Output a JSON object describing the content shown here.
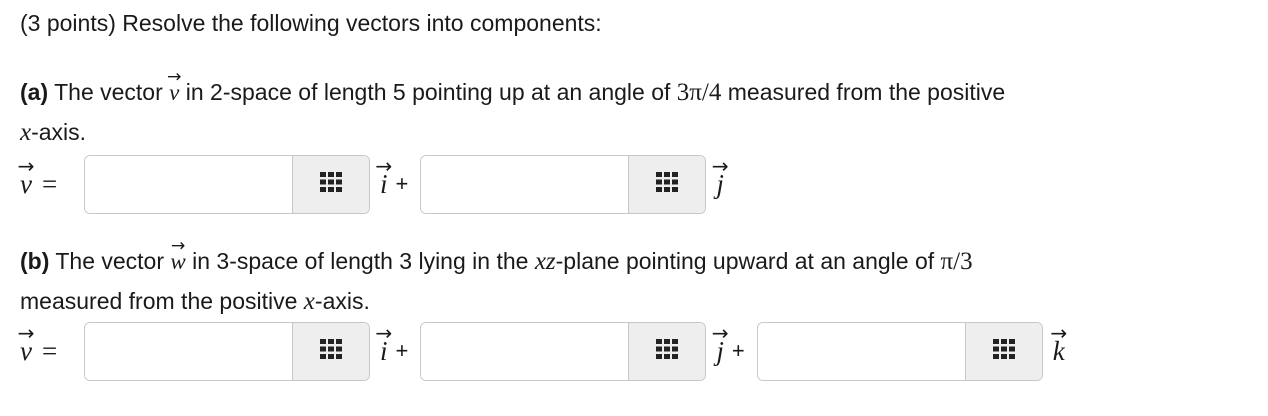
{
  "header": "(3 points) Resolve the following vectors into components:",
  "part_a": {
    "label": "(a)",
    "text1": " The vector ",
    "vec": "v",
    "text2": " in 2-space of length 5 pointing up at an angle of ",
    "angle": "3π/4",
    "text3": " measured from the positive",
    "line2_var": "x",
    "line2_text": "-axis.",
    "lhs": "v",
    "equals": "=",
    "units": [
      "i",
      "j"
    ],
    "plus": "+",
    "answers": [
      "",
      ""
    ]
  },
  "part_b": {
    "label": "(b)",
    "text1": " The vector ",
    "vec": "w",
    "text2": " in 3-space of length 3 lying in the ",
    "plane": "xz",
    "text3": "-plane pointing upward at an angle of ",
    "angle": "π/3",
    "line2_text1": "measured from the positive ",
    "line2_var": "x",
    "line2_text2": "-axis.",
    "lhs": "v",
    "equals": "=",
    "units": [
      "i",
      "j",
      "k"
    ],
    "plus": "+",
    "answers": [
      "",
      "",
      ""
    ]
  },
  "icons": {
    "palette": "grid-palette-icon"
  },
  "colors": {
    "field_border": "#c8c8c8",
    "palette_bg": "#eeeeee",
    "icon": "#222222"
  }
}
